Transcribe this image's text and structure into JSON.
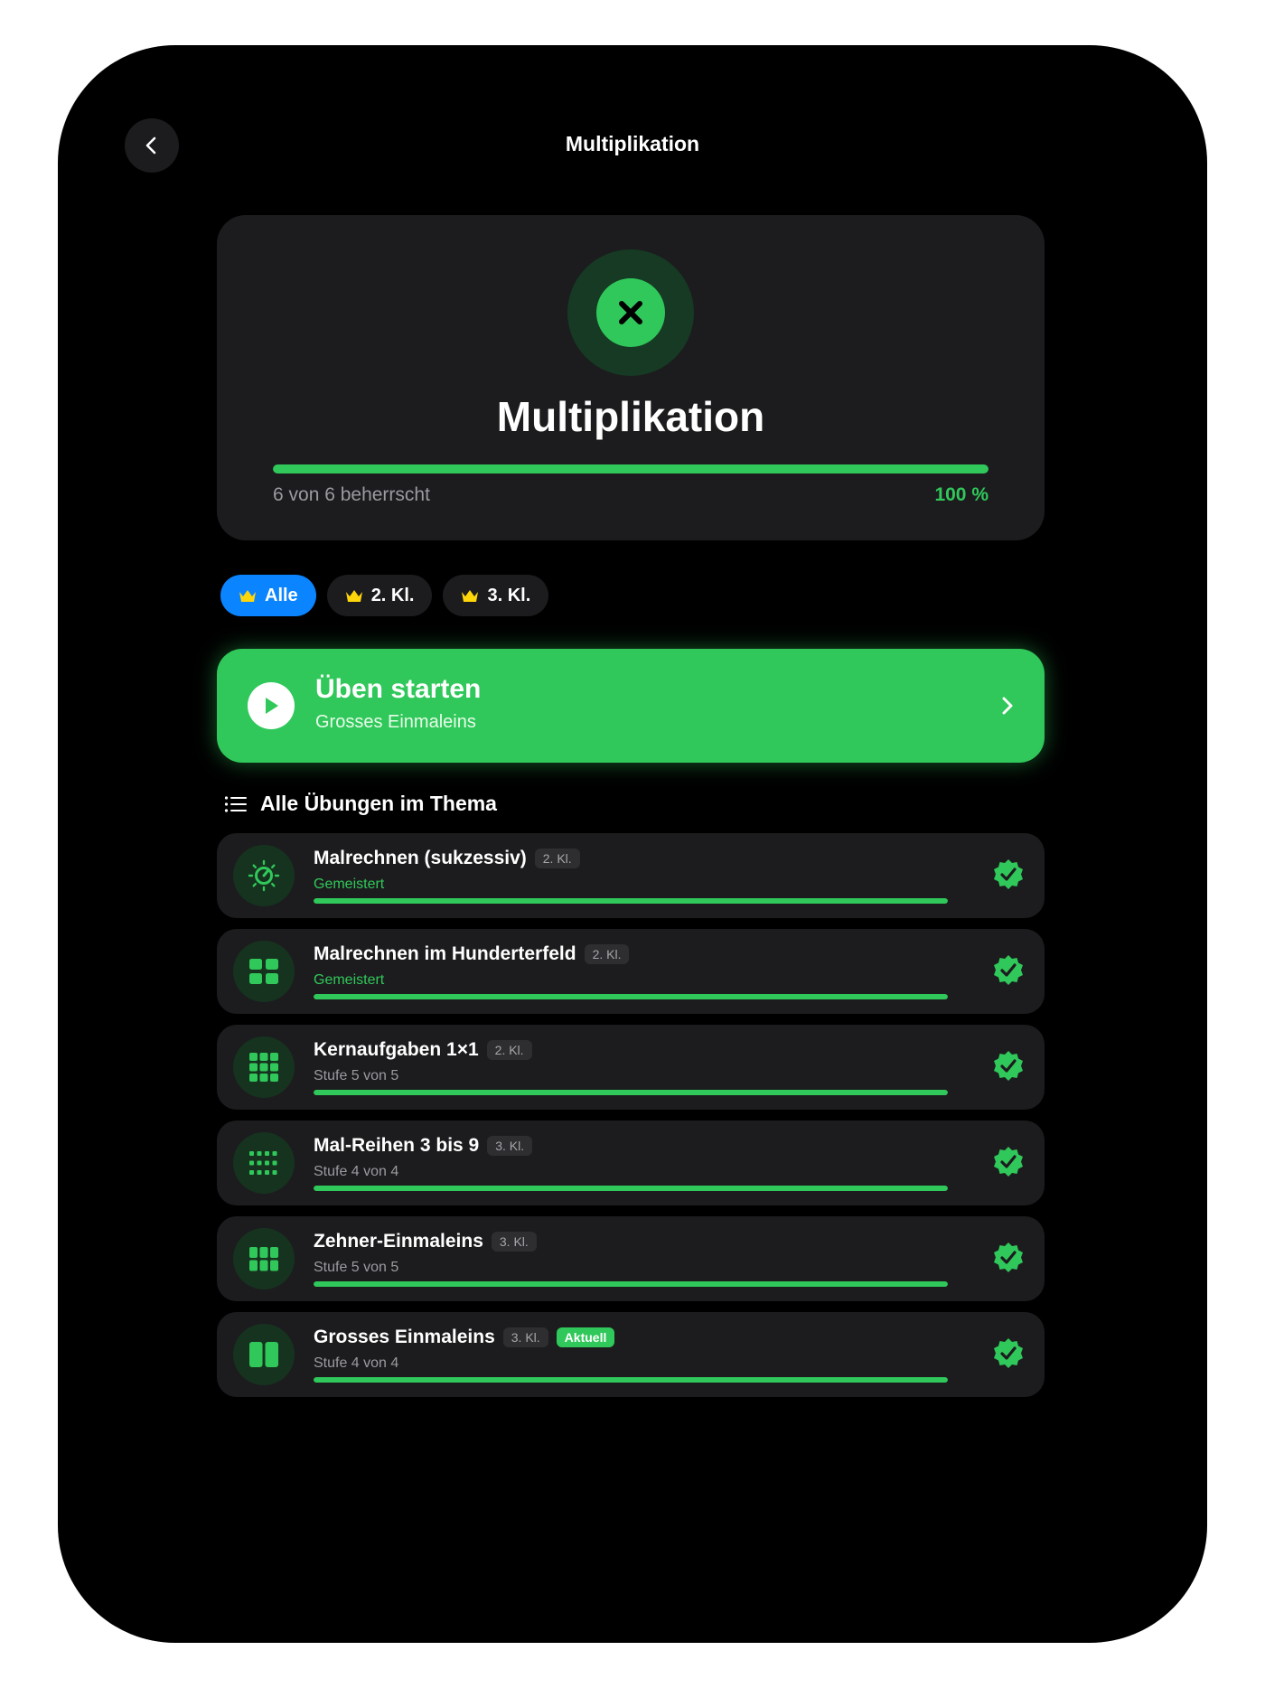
{
  "nav": {
    "title": "Multiplikation"
  },
  "hero": {
    "title": "Multiplikation",
    "caption": "6 von 6 beherrscht",
    "percent_label": "100 %",
    "progress": 1.0
  },
  "filters": [
    {
      "label": "Alle",
      "active": true
    },
    {
      "label": "2. Kl.",
      "active": false
    },
    {
      "label": "3. Kl.",
      "active": false
    }
  ],
  "start": {
    "title": "Üben starten",
    "subtitle": "Grosses Einmaleins"
  },
  "section": {
    "title": "Alle Übungen im Thema"
  },
  "exercises": [
    {
      "title": "Malrechnen (sukzessiv)",
      "grade": "2. Kl.",
      "status": "Gemeistert",
      "mastered": true,
      "progress": 1.0,
      "icon": "dial-icon"
    },
    {
      "title": "Malrechnen im Hunderterfeld",
      "grade": "2. Kl.",
      "status": "Gemeistert",
      "mastered": true,
      "progress": 1.0,
      "icon": "grid-2x2-icon"
    },
    {
      "title": "Kernaufgaben 1×1",
      "grade": "2. Kl.",
      "status": "Stufe 5 von 5",
      "mastered": false,
      "progress": 1.0,
      "icon": "grid-3x3-icon"
    },
    {
      "title": "Mal-Reihen 3 bis 9",
      "grade": "3. Kl.",
      "status": "Stufe 4 von 4",
      "mastered": false,
      "progress": 1.0,
      "icon": "dot-grid-icon"
    },
    {
      "title": "Zehner-Einmaleins",
      "grade": "3. Kl.",
      "status": "Stufe 5 von 5",
      "mastered": false,
      "progress": 1.0,
      "icon": "grid-3x2-icon"
    },
    {
      "title": "Grosses Einmaleins",
      "grade": "3. Kl.",
      "badge": "Aktuell",
      "status": "Stufe 4 von 4",
      "mastered": false,
      "progress": 1.0,
      "icon": "columns-icon"
    }
  ],
  "colors": {
    "accent": "#30c85a",
    "active_chip": "#0a84ff",
    "crown": "#ffd60a",
    "card": "#1c1c1e"
  }
}
